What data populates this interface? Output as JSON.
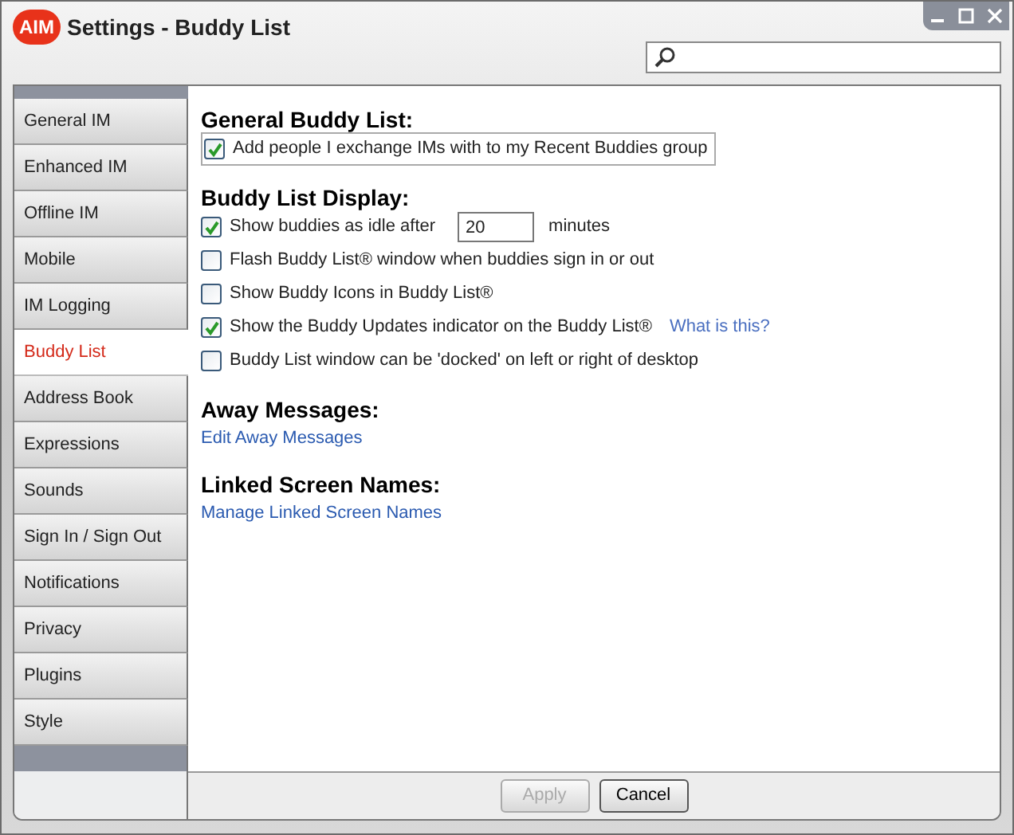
{
  "window": {
    "title": "Settings - Buddy List",
    "logo": "AIM"
  },
  "sidebar": {
    "items": [
      {
        "label": "General IM",
        "selected": false
      },
      {
        "label": "Enhanced IM",
        "selected": false
      },
      {
        "label": "Offline IM",
        "selected": false
      },
      {
        "label": "Mobile",
        "selected": false
      },
      {
        "label": "IM Logging",
        "selected": false
      },
      {
        "label": "Buddy List",
        "selected": true
      },
      {
        "label": "Address Book",
        "selected": false
      },
      {
        "label": "Expressions",
        "selected": false
      },
      {
        "label": "Sounds",
        "selected": false
      },
      {
        "label": "Sign In / Sign Out",
        "selected": false
      },
      {
        "label": "Notifications",
        "selected": false
      },
      {
        "label": "Privacy",
        "selected": false
      },
      {
        "label": "Plugins",
        "selected": false
      },
      {
        "label": "Style",
        "selected": false
      }
    ]
  },
  "sections": [
    {
      "heading": "General Buddy List:",
      "items": [
        {
          "kind": "checkbox",
          "label": "Add people I exchange IMs with to my Recent Buddies group",
          "checked": true,
          "focused": true
        }
      ]
    },
    {
      "heading": "Buddy List Display:",
      "items": [
        {
          "kind": "checkbox",
          "label": "Show buddies as idle after",
          "checked": true,
          "field": "20",
          "suffix": "minutes"
        },
        {
          "kind": "checkbox",
          "label": "Flash Buddy List® window when buddies sign in or out",
          "checked": false
        },
        {
          "kind": "checkbox",
          "label": "Show Buddy Icons in Buddy List®",
          "checked": false
        },
        {
          "kind": "checkbox",
          "label": "Show the Buddy Updates indicator on the Buddy List®",
          "checked": true,
          "link": "What is this?"
        },
        {
          "kind": "checkbox",
          "label": "Buddy List window can be 'docked' on left or right of desktop",
          "checked": false
        }
      ]
    },
    {
      "heading": "Away Messages:",
      "items": [
        {
          "kind": "link",
          "label": "Edit Away Messages"
        }
      ]
    },
    {
      "heading": "Linked Screen Names:",
      "items": [
        {
          "kind": "link",
          "label": "Manage Linked Screen Names"
        }
      ]
    }
  ],
  "buttons": [
    {
      "label": "Apply",
      "disabled": true
    },
    {
      "label": "Cancel",
      "disabled": false
    }
  ]
}
